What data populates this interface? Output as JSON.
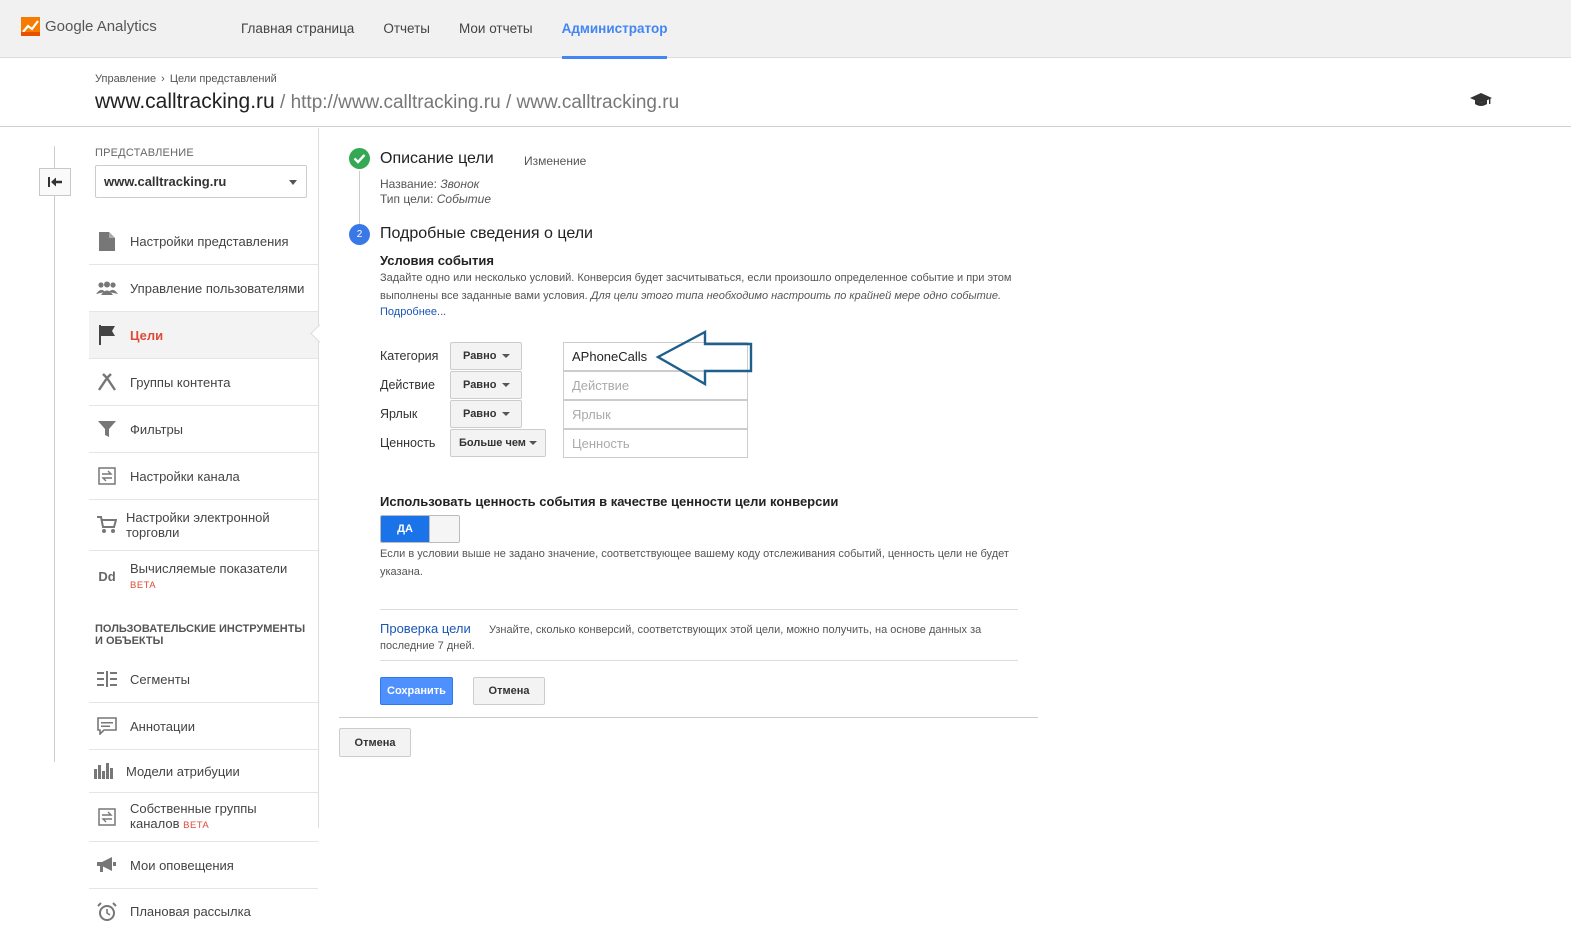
{
  "app": {
    "name": "Google Analytics"
  },
  "nav": {
    "items": [
      {
        "label": "Главная страница"
      },
      {
        "label": "Отчеты"
      },
      {
        "label": "Мои отчеты"
      },
      {
        "label": "Администратор"
      }
    ]
  },
  "header": {
    "breadcrumb": [
      "Управление",
      "Цели представлений"
    ],
    "breadcrumb_sep": "›",
    "title": "www.calltracking.ru",
    "subtitle": " / http://www.calltracking.ru / www.calltracking.ru"
  },
  "sidebar": {
    "section_label": "ПРЕДСТАВЛЕНИЕ",
    "view_select": "www.calltracking.ru",
    "items": [
      {
        "label": "Настройки представления",
        "icon": "document-icon"
      },
      {
        "label": "Управление пользователями",
        "icon": "users-icon"
      },
      {
        "label": "Цели",
        "icon": "flag-icon"
      },
      {
        "label": "Группы контента",
        "icon": "content-groups-icon"
      },
      {
        "label": "Фильтры",
        "icon": "filter-icon"
      },
      {
        "label": "Настройки канала",
        "icon": "channel-icon"
      },
      {
        "label": "Настройки электронной торговли",
        "icon": "cart-icon"
      },
      {
        "label": "Вычисляемые показатели",
        "badge": "BETA",
        "icon": "dd-icon",
        "icon_text": "Dd"
      }
    ],
    "group_label": "ПОЛЬЗОВАТЕЛЬСКИЕ ИНСТРУМЕНТЫ И ОБЪЕКТЫ",
    "group_items": [
      {
        "label": "Сегменты",
        "icon": "segments-icon"
      },
      {
        "label": "Аннотации",
        "icon": "annotations-icon"
      },
      {
        "label": "Модели атрибуции",
        "icon": "attribution-icon"
      },
      {
        "label": "Собственные группы каналов",
        "badge": "BETA",
        "icon": "custom-channel-icon"
      },
      {
        "label": "Мои оповещения",
        "icon": "megaphone-icon"
      },
      {
        "label": "Плановая рассылка",
        "icon": "alarm-clock-icon"
      }
    ]
  },
  "goal": {
    "step1": {
      "title": "Описание цели",
      "edit": "Изменение",
      "name_label": "Название:",
      "name_value": "Звонок",
      "type_label": "Тип цели:",
      "type_value": "Событие"
    },
    "step2": {
      "number": "2",
      "title": "Подробные сведения о цели",
      "subhead": "Условия события",
      "desc": "Задайте одно или несколько условий. Конверсия будет засчитываться, если произошло определенное событие и при этом выполнены все заданные вами условия.",
      "desc_italic": "Для цели этого типа необходимо настроить по крайней мере одно событие.",
      "more": "Подробнее..."
    },
    "conditions": [
      {
        "label": "Категория",
        "op": "Равно",
        "value": "APhoneCalls",
        "placeholder": "Категория"
      },
      {
        "label": "Действие",
        "op": "Равно",
        "value": "",
        "placeholder": "Действие"
      },
      {
        "label": "Ярлык",
        "op": "Равно",
        "value": "",
        "placeholder": "Ярлык"
      },
      {
        "label": "Ценность",
        "op": "Больше чем",
        "value": "",
        "placeholder": "Ценность"
      }
    ],
    "use_value": {
      "title": "Использовать ценность события в качестве ценности цели конверсии",
      "toggle": "ДА",
      "desc": "Если в условии выше не задано значение, соответствующее вашему коду отслеживания событий, ценность цели не будет указана."
    },
    "verify": {
      "link": "Проверка цели",
      "desc": "Узнайте, сколько конверсий, соответствующих этой цели, можно получить, на основе данных за последние 7 дней."
    },
    "buttons": {
      "save": "Сохранить",
      "cancel": "Отмена",
      "cancel_outer": "Отмена"
    }
  },
  "colors": {
    "accent": "#4285f4",
    "active": "#dd4b39",
    "success": "#34a853",
    "arrow": "#1f5f8b"
  }
}
